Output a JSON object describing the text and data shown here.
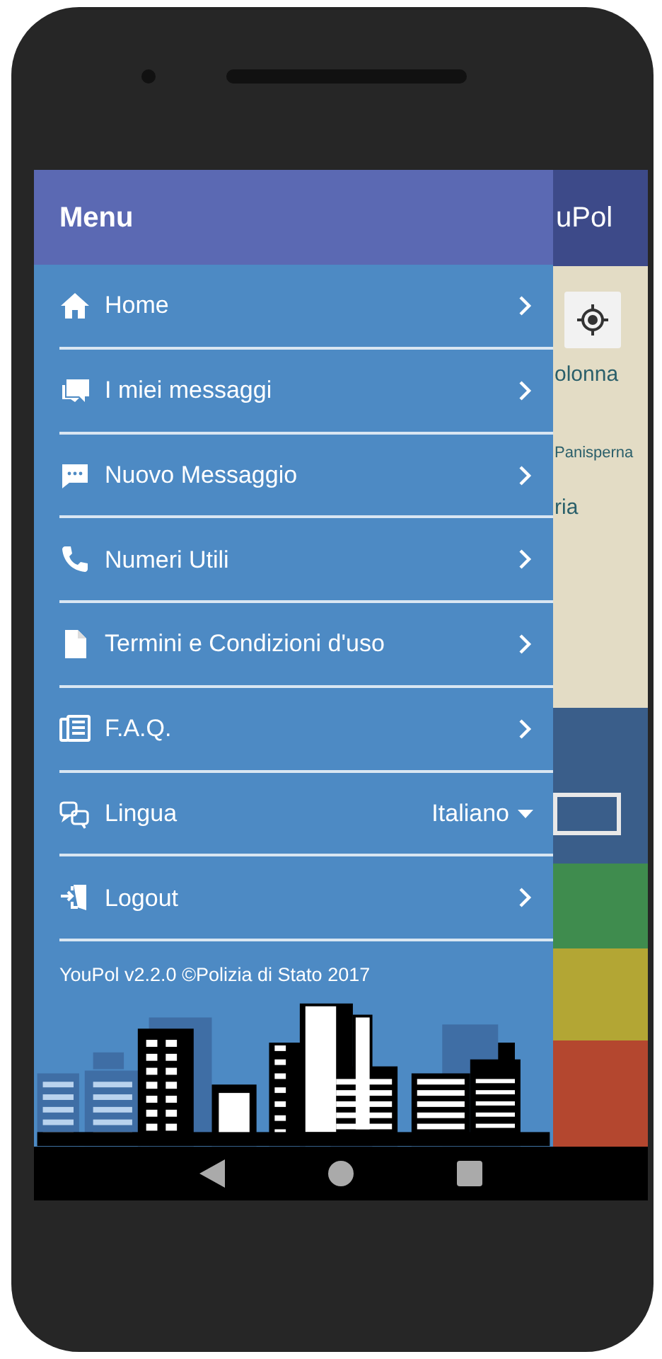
{
  "background_app": {
    "title": "uPol",
    "map_labels": [
      "olonna",
      "Panisperna",
      "ria"
    ]
  },
  "drawer": {
    "title": "Menu",
    "items": [
      {
        "kind": "link",
        "label": "Home"
      },
      {
        "kind": "link",
        "label": "I miei messaggi"
      },
      {
        "kind": "link",
        "label": "Nuovo Messaggio"
      },
      {
        "kind": "link",
        "label": "Numeri Utili"
      },
      {
        "kind": "link",
        "label": "Termini e Condizioni d'uso"
      },
      {
        "kind": "link",
        "label": "F.A.Q."
      },
      {
        "kind": "dropdown",
        "label": "Lingua",
        "value": "Italiano"
      },
      {
        "kind": "link",
        "label": "Logout"
      }
    ],
    "footer": "YouPol v2.2.0 ©Polizia di Stato 2017"
  }
}
